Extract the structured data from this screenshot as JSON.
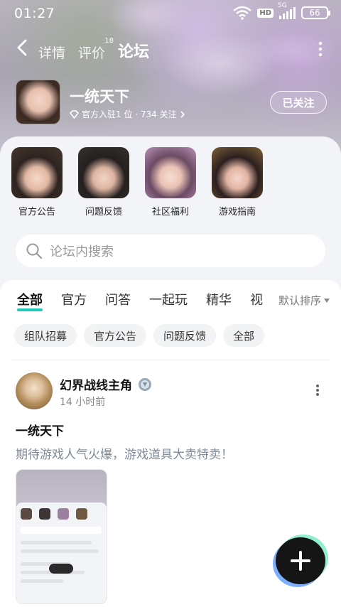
{
  "status": {
    "time": "01:27",
    "network": "5G",
    "hd": "HD",
    "battery": "66"
  },
  "nav": {
    "tabs": [
      {
        "label": "详情"
      },
      {
        "label": "评价",
        "badge": "18"
      },
      {
        "label": "论坛"
      }
    ]
  },
  "forum": {
    "name": "一统天下",
    "meta": "官方入驻1 位 · 734 关注",
    "follow_label": "已关注"
  },
  "categories": [
    {
      "label": "官方公告"
    },
    {
      "label": "问题反馈"
    },
    {
      "label": "社区福利"
    },
    {
      "label": "游戏指南"
    }
  ],
  "search": {
    "placeholder": "论坛内搜索"
  },
  "tabs": [
    {
      "label": "全部"
    },
    {
      "label": "官方"
    },
    {
      "label": "问答"
    },
    {
      "label": "一起玩"
    },
    {
      "label": "精华"
    },
    {
      "label": "视"
    }
  ],
  "sort_label": "默认排序",
  "chips": [
    {
      "label": "组队招募"
    },
    {
      "label": "官方公告"
    },
    {
      "label": "问题反馈"
    },
    {
      "label": "全部"
    }
  ],
  "post": {
    "author": "幻界战线主角",
    "time": "14 小时前",
    "title": "一统天下",
    "body": "期待游戏人气火爆，游戏道具大卖特卖！"
  },
  "colors": {
    "accent": "#23c9b8",
    "panel_bg": "#f3f4f7",
    "muted_text": "#7d8a98"
  }
}
